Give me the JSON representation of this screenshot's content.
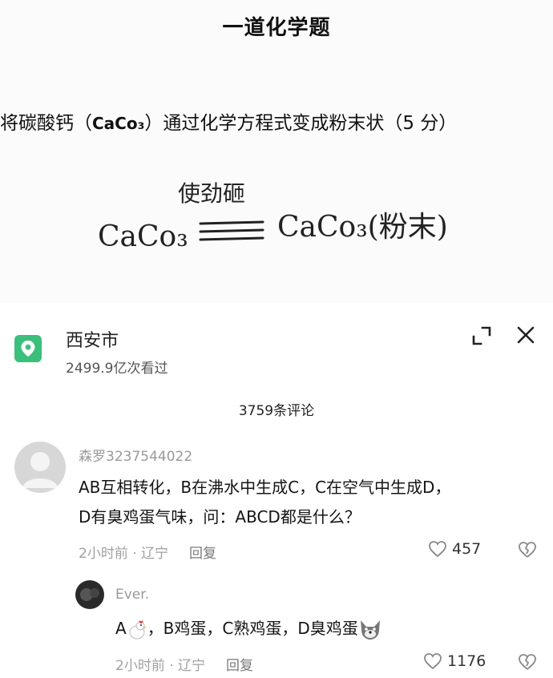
{
  "question": {
    "title": "一道化学题",
    "body_prefix": "将碳酸钙（",
    "body_formula": "CaCo₃",
    "body_suffix": "）通过化学方程式变成粉末状（5 分）",
    "handwritten_condition": "使劲砸",
    "handwritten_left": "CaCo₃",
    "handwritten_right": "CaCo₃(粉末)"
  },
  "location": {
    "name": "西安市",
    "views": "2499.9亿次看过"
  },
  "comments_header": "3759条评论",
  "comments": [
    {
      "username": "森罗3237544022",
      "line1": "AB互相转化，B在沸水中生成C，C在空气中生成D，",
      "line2": "D有臭鸡蛋气味，问：ABCD都是什么？",
      "time": "2小时前",
      "region": "辽宁",
      "reply_label": "回复",
      "likes": "457"
    },
    {
      "username": "Ever.",
      "text_a": "A",
      "text_rest": "，B鸡蛋，C熟鸡蛋，D臭鸡蛋",
      "time": "2小时前",
      "region": "辽宁",
      "reply_label": "回复",
      "likes": "1176"
    }
  ],
  "colors": {
    "pin": "#3cbf7a",
    "muted": "#a0a0a0"
  }
}
